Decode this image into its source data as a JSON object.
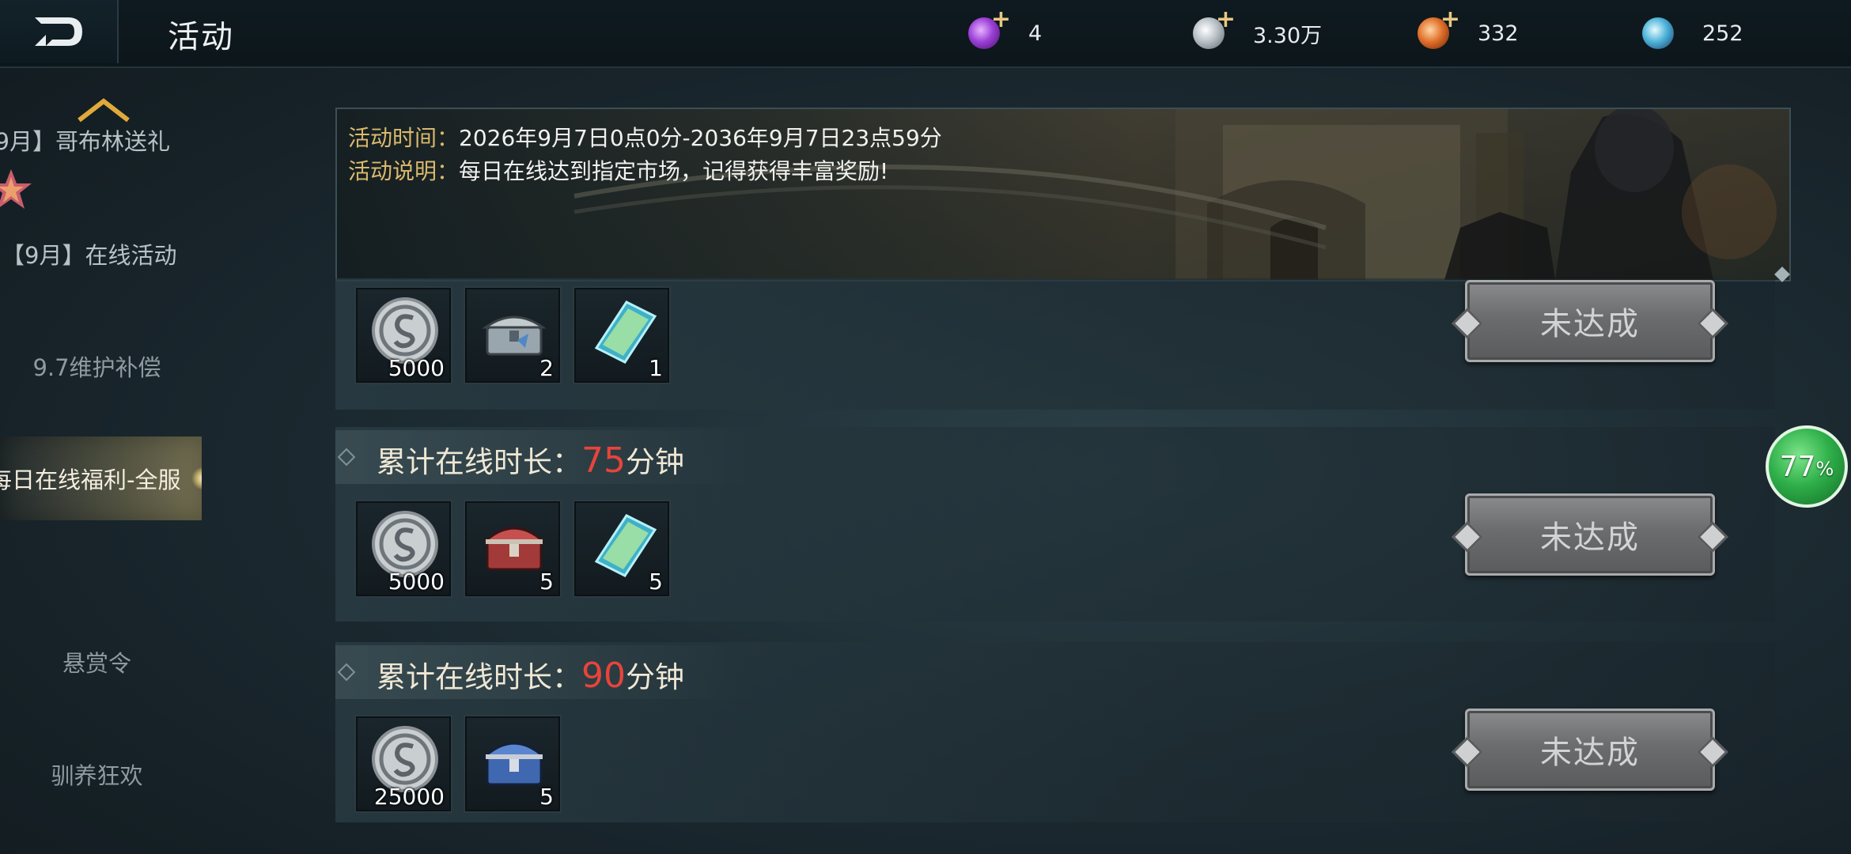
{
  "header": {
    "title": "活动",
    "currencies": [
      {
        "icon": "purple-gem-icon",
        "amount": "4",
        "has_plus": true
      },
      {
        "icon": "silver-coin-icon",
        "amount": "3.30万",
        "has_plus": true
      },
      {
        "icon": "orange-orb-icon",
        "amount": "332",
        "has_plus": true
      },
      {
        "icon": "blue-crystal-icon",
        "amount": "252",
        "has_plus": false
      }
    ]
  },
  "sidebar": {
    "items": [
      {
        "label": "9月】哥布林送礼",
        "active": false
      },
      {
        "label": "【9月】在线活动",
        "active": false
      },
      {
        "label": "9.7维护补偿",
        "active": false
      },
      {
        "label": "每日在线福利-全服",
        "active": true
      },
      {
        "label": "悬赏令",
        "active": false
      },
      {
        "label": "驯养狂欢",
        "active": false
      }
    ]
  },
  "banner": {
    "time_label": "活动时间：",
    "time_value": "2026年9月7日0点0分-2036年9月7日23点59分",
    "desc_label": "活动说明：",
    "desc_value": "每日在线达到指定市场，记得获得丰富奖励!"
  },
  "rows": [
    {
      "header_prefix": null,
      "minutes": null,
      "unit": null,
      "items": [
        {
          "icon": "silver-coin-icon",
          "qty": "5000"
        },
        {
          "icon": "silver-chest-icon",
          "qty": "2"
        },
        {
          "icon": "blue-scroll-icon",
          "qty": "1"
        }
      ],
      "status": "未达成"
    },
    {
      "header_prefix": "累计在线时长：",
      "minutes": "75",
      "unit": "分钟",
      "items": [
        {
          "icon": "silver-coin-icon",
          "qty": "5000"
        },
        {
          "icon": "red-chest-icon",
          "qty": "5"
        },
        {
          "icon": "blue-scroll-icon",
          "qty": "5"
        }
      ],
      "status": "未达成"
    },
    {
      "header_prefix": "累计在线时长：",
      "minutes": "90",
      "unit": "分钟",
      "items": [
        {
          "icon": "silver-coin-icon",
          "qty": "25000"
        },
        {
          "icon": "blue-chest-icon",
          "qty": "5"
        }
      ],
      "status": "未达成"
    }
  ],
  "progress_badge": {
    "value": "77",
    "unit": "%"
  },
  "colors": {
    "accent_gold": "#d9b96c",
    "minutes_red": "#e8443a",
    "progress_green": "#2fb04a",
    "button_gray": "#6b6c6e"
  }
}
